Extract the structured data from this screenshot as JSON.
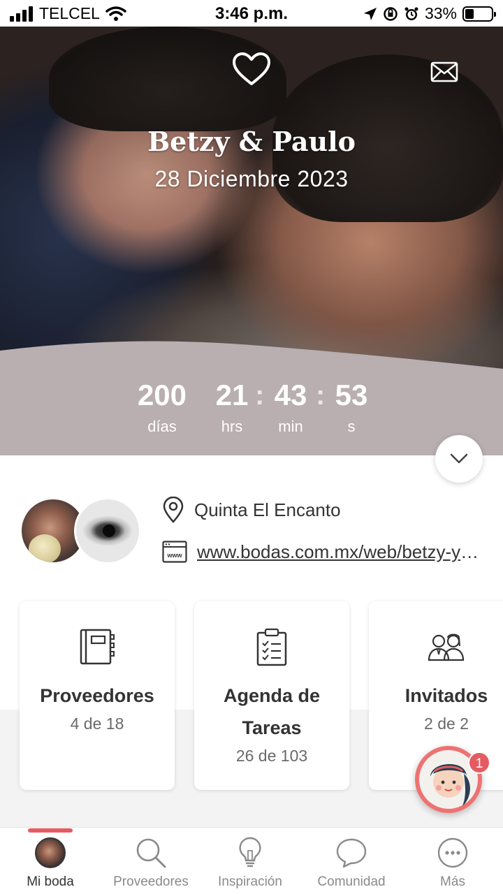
{
  "status_bar": {
    "carrier": "TELCEL",
    "time": "3:46 p.m.",
    "battery": "33%",
    "battery_level": 0.33
  },
  "hero": {
    "names": "Betzy & Paulo",
    "date": "28 Diciembre 2023",
    "icons": {
      "top_center": "heart-icon",
      "top_right": "mail-icon"
    }
  },
  "countdown": {
    "days": "200",
    "days_label": "días",
    "hours": "21",
    "hours_label": "hrs",
    "minutes": "43",
    "minutes_label": "min",
    "seconds": "53",
    "seconds_label": "s",
    "separator": ":"
  },
  "info": {
    "venue": "Quinta El Encanto",
    "website": "www.bodas.com.mx/web/betzy-y-paulo"
  },
  "cards": [
    {
      "title": "Proveedores",
      "subtitle": "4 de 18",
      "icon": "notebook-icon"
    },
    {
      "title": "Agenda de Tareas",
      "title_line1": "Agenda de",
      "title_line2": "Tareas",
      "subtitle": "26 de 103",
      "icon": "clipboard-checklist-icon"
    },
    {
      "title": "Invitados",
      "subtitle": "2 de 2",
      "icon": "guests-icon"
    }
  ],
  "assistant": {
    "badge": "1"
  },
  "tabs": [
    {
      "label": "Mi boda",
      "icon": "avatar",
      "active": true
    },
    {
      "label": "Proveedores",
      "icon": "search-icon"
    },
    {
      "label": "Inspiración",
      "icon": "lightbulb-icon"
    },
    {
      "label": "Comunidad",
      "icon": "chat-bubble-icon"
    },
    {
      "label": "Más",
      "icon": "more-icon"
    }
  ],
  "colors": {
    "accent": "#e45b62",
    "countdown_band": "#b9aeb0",
    "text": "#333333"
  }
}
